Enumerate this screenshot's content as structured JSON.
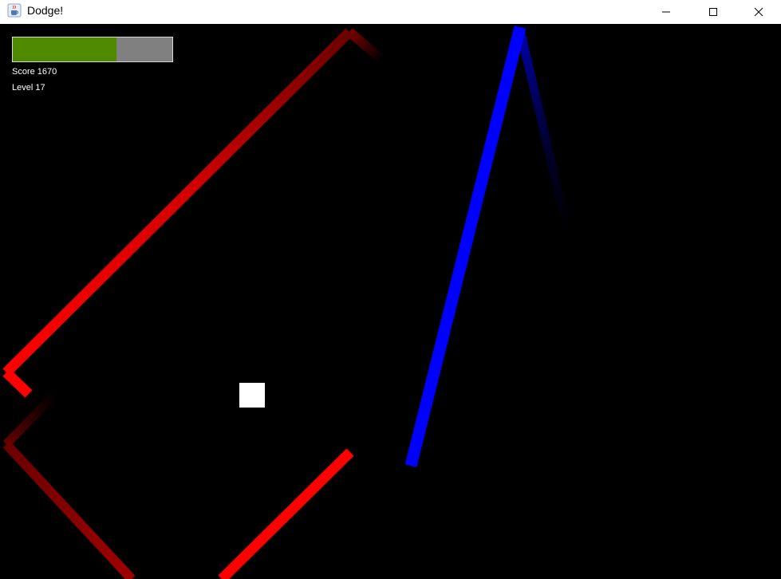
{
  "window": {
    "title": "Dodge!",
    "app_icon": "java-coffee-cup-icon",
    "controls": [
      "minimize-icon",
      "maximize-icon",
      "close-icon"
    ]
  },
  "hud": {
    "health_fraction": 0.65,
    "health_color": "#4f8a00",
    "health_track_color": "#808080",
    "score_label": "Score 1670",
    "level_label": "Level 17"
  },
  "game": {
    "background_color": "#000000",
    "player_color": "#ffffff",
    "red_enemy_color": "#ff0000",
    "blue_enemy_color": "#0000ff"
  }
}
